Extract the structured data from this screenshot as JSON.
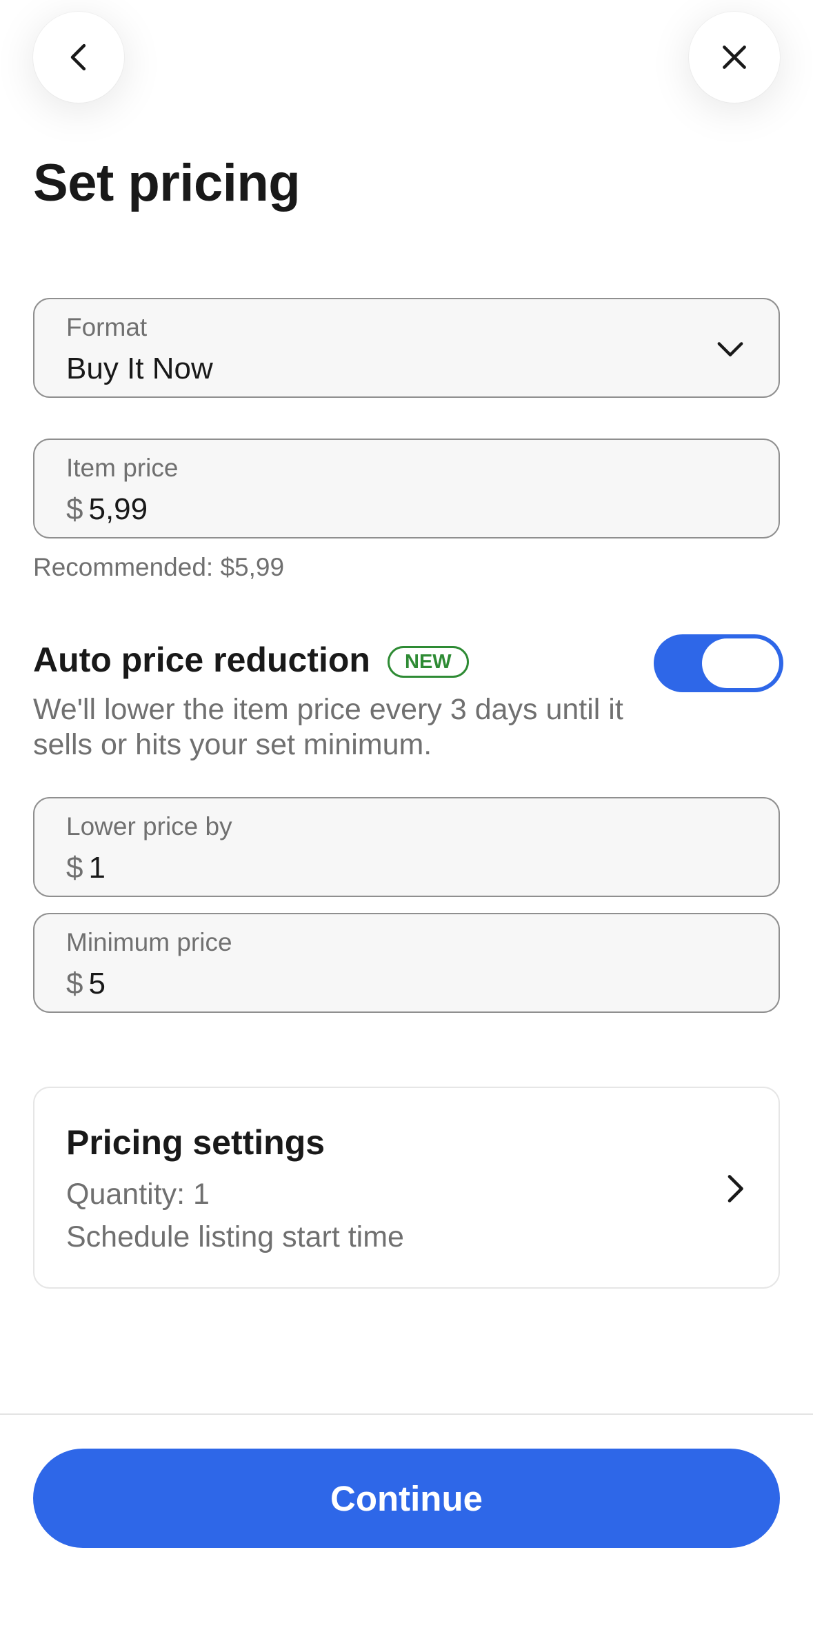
{
  "header": {
    "back_icon": "chevron-left-icon",
    "close_icon": "close-icon"
  },
  "page_title": "Set pricing",
  "format_field": {
    "label": "Format",
    "value": "Buy It Now",
    "icon": "chevron-down-icon"
  },
  "item_price_field": {
    "label": "Item price",
    "currency": "$",
    "value": "5,99",
    "recommended": "Recommended: $5,99"
  },
  "auto_price_reduction": {
    "title": "Auto price reduction",
    "badge": "NEW",
    "description": "We'll lower the item price every 3 days until it sells or hits your set minimum.",
    "toggle_on": true,
    "toggle_color": "#2e67e8"
  },
  "lower_price_field": {
    "label": "Lower price by",
    "currency": "$",
    "value": "1"
  },
  "minimum_price_field": {
    "label": "Minimum price",
    "currency": "$",
    "value": "5"
  },
  "pricing_settings": {
    "title": "Pricing settings",
    "quantity": "Quantity: 1",
    "schedule": "Schedule listing start time",
    "icon": "chevron-right-icon"
  },
  "footer": {
    "continue_label": "Continue",
    "button_color": "#2e67e8"
  }
}
